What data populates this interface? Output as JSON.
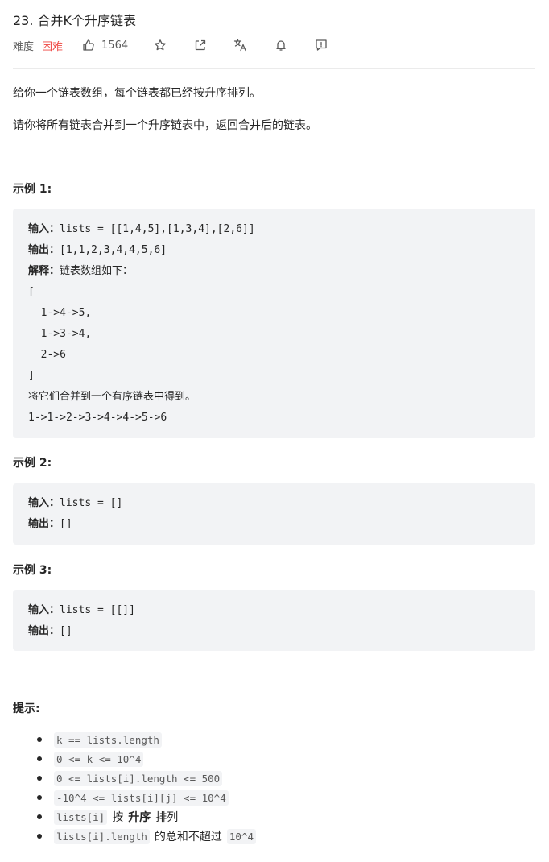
{
  "problem": {
    "title": "23. 合并K个升序链表",
    "difficulty_label": "难度",
    "difficulty": "困难",
    "likes": "1564"
  },
  "icons": [
    "like-icon",
    "star-icon",
    "share-icon",
    "translate-icon",
    "bell-icon",
    "feedback-icon"
  ],
  "colors": {
    "difficulty": "#ef4743",
    "code_bg": "#f2f3f5"
  },
  "description": {
    "p1": "给你一个链表数组，每个链表都已经按升序排列。",
    "p2": "请你将所有链表合并到一个升序链表中，返回合并后的链表。"
  },
  "examples": [
    {
      "heading": "示例 1:",
      "input_label": "输入：",
      "input": "lists = [[1,4,5],[1,3,4],[2,6]]",
      "output_label": "输出：",
      "output": "[1,1,2,3,4,4,5,6]",
      "explain_label": "解释：",
      "explain": "链表数组如下：",
      "lines": [
        "[",
        "  1->4->5,",
        "  1->3->4,",
        "  2->6",
        "]"
      ],
      "merge_text": "将它们合并到一个有序链表中得到。",
      "result": "1->1->2->3->4->4->5->6"
    },
    {
      "heading": "示例 2:",
      "input_label": "输入：",
      "input": "lists = []",
      "output_label": "输出：",
      "output": "[]"
    },
    {
      "heading": "示例 3:",
      "input_label": "输入：",
      "input": "lists = [[]]",
      "output_label": "输出：",
      "output": "[]"
    }
  ],
  "hints": {
    "heading": "提示:",
    "items": [
      {
        "code": "k == lists.length"
      },
      {
        "code": "0 <= k <= 10^4"
      },
      {
        "code": "0 <= lists[i].length <= 500"
      },
      {
        "code": "-10^4 <= lists[i][j] <= 10^4"
      },
      {
        "code": "lists[i]",
        "text1": "按",
        "bold": "升序",
        "text2": "排列"
      },
      {
        "code": "lists[i].length",
        "text1": "的总和不超过",
        "code2": "10^4"
      }
    ]
  }
}
